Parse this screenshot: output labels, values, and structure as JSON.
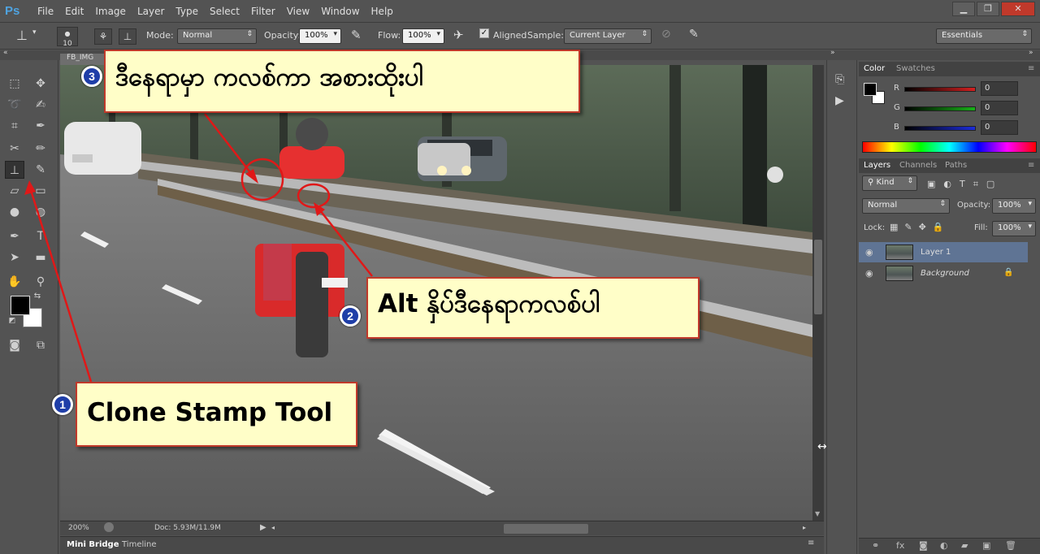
{
  "app": {
    "logo": "Ps",
    "menu": [
      "File",
      "Edit",
      "Image",
      "Layer",
      "Type",
      "Select",
      "Filter",
      "View",
      "Window",
      "Help"
    ]
  },
  "options": {
    "brush_size": "10",
    "mode_label": "Mode:",
    "mode_value": "Normal",
    "opacity_label": "Opacity:",
    "opacity_value": "100%",
    "flow_label": "Flow:",
    "flow_value": "100%",
    "aligned_label": "Aligned",
    "sample_label": "Sample:",
    "sample_value": "Current Layer",
    "workspace": "Essentials"
  },
  "document": {
    "tab": "FB_IMG",
    "zoom": "200%",
    "doc_info": "Doc: 5.93M/11.9M"
  },
  "bottom_tabs": [
    "Mini Bridge",
    "Timeline"
  ],
  "color_panel": {
    "tabs": [
      "Color",
      "Swatches"
    ],
    "channels": [
      {
        "label": "R",
        "value": "0",
        "color": "#d42020"
      },
      {
        "label": "G",
        "value": "0",
        "color": "#18b018"
      },
      {
        "label": "B",
        "value": "0",
        "color": "#1c2cd8"
      }
    ]
  },
  "layers_panel": {
    "tabs": [
      "Layers",
      "Channels",
      "Paths"
    ],
    "kind": "Kind",
    "blend_mode": "Normal",
    "opacity_label": "Opacity:",
    "opacity_value": "100%",
    "lock_label": "Lock:",
    "fill_label": "Fill:",
    "fill_value": "100%",
    "layers": [
      {
        "name": "Layer 1",
        "selected": true
      },
      {
        "name": "Background",
        "selected": false
      }
    ]
  },
  "annotations": {
    "step1": {
      "badge": "1",
      "text": "Clone Stamp Tool"
    },
    "step2": {
      "badge": "2",
      "text": "Alt နှိပ်ဒီနေရာကလစ်ပါ"
    },
    "step3": {
      "badge": "3",
      "text": "ဒီနေရာမှာ ကလစ်ကာ အစားထိုးပါ"
    }
  },
  "colors": {
    "callout_bg": "#fffec8",
    "callout_border": "#c0392b",
    "badge": "#1f3ea8",
    "arrow": "#e01818"
  }
}
